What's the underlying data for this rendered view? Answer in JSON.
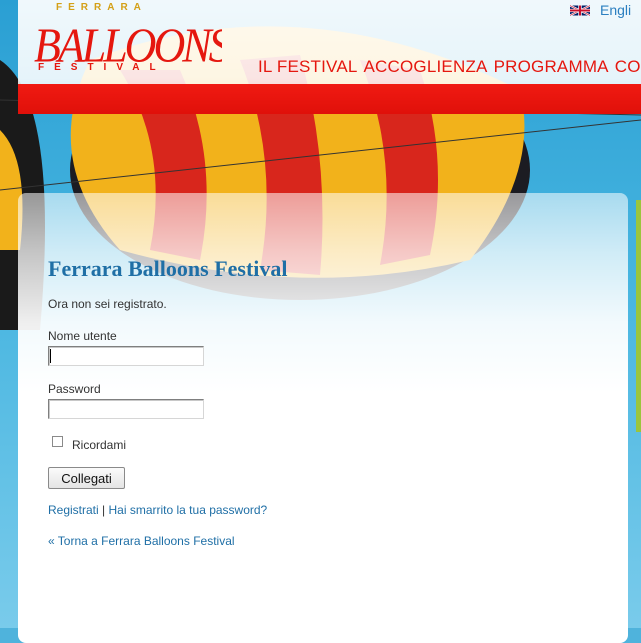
{
  "header": {
    "language": {
      "label": "Engli",
      "flag": "uk-flag-icon"
    },
    "nav": [
      "IL FESTIVAL",
      "ACCOGLIENZA",
      "PROGRAMMA",
      "CONC"
    ],
    "logo": {
      "top_text": "FERRARA",
      "main_text": "BALLOONS",
      "bottom_text": "FESTIVAL"
    }
  },
  "login": {
    "title": "Ferrara Balloons Festival",
    "status_message": "Ora non sei registrato.",
    "username_label": "Nome utente",
    "username_value": "",
    "password_label": "Password",
    "password_value": "",
    "remember_label": "Ricordami",
    "remember_checked": false,
    "submit_label": "Collegati",
    "register_link": "Registrati",
    "separator": "|",
    "lost_password_link": "Hai smarrito la tua password?",
    "back_link": "« Torna a Ferrara Balloons Festival"
  },
  "colors": {
    "brand_red": "#e5170f",
    "link_blue": "#1f6fa6",
    "sky_blue": "#47b5e0",
    "accent_green": "#9bc53d"
  }
}
